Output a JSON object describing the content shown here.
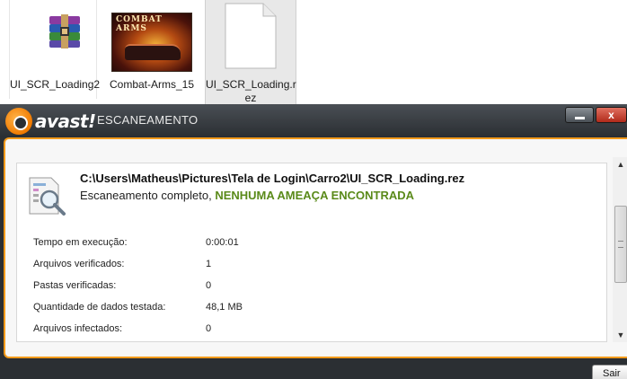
{
  "desktop": {
    "files": [
      {
        "name": "UI_SCR_Loading2",
        "icon": "winrar-archive-icon"
      },
      {
        "name": "Combat-Arms_15",
        "icon": "game-thumbnail",
        "thumb_title": "COMBAT ARMS"
      },
      {
        "name_line1": "UI_SCR_Loading.r",
        "name_line2": "ez",
        "icon": "blank-document-icon"
      }
    ]
  },
  "window": {
    "brand": "avast!",
    "title": "ESCANEAMENTO",
    "close_label": "x",
    "scan": {
      "path": "C:\\Users\\Matheus\\Pictures\\Tela de Login\\Carro2\\UI_SCR_Loading.rez",
      "status_prefix": "Escaneamento completo, ",
      "status_result": "NENHUMA AMEAÇA ENCONTRADA"
    },
    "stats": [
      {
        "label": "Tempo em execução:",
        "value": "0:00:01"
      },
      {
        "label": "Arquivos verificados:",
        "value": "1"
      },
      {
        "label": "Pastas verificadas:",
        "value": "0"
      },
      {
        "label": "Quantidade de dados testada:",
        "value": "48,1 MB"
      },
      {
        "label": "Arquivos infectados:",
        "value": "0"
      }
    ],
    "exit_label": "Sair"
  },
  "colors": {
    "accent": "#f39a1a",
    "ok_green": "#5a8a1a",
    "titlebar": "#2b2f33"
  }
}
